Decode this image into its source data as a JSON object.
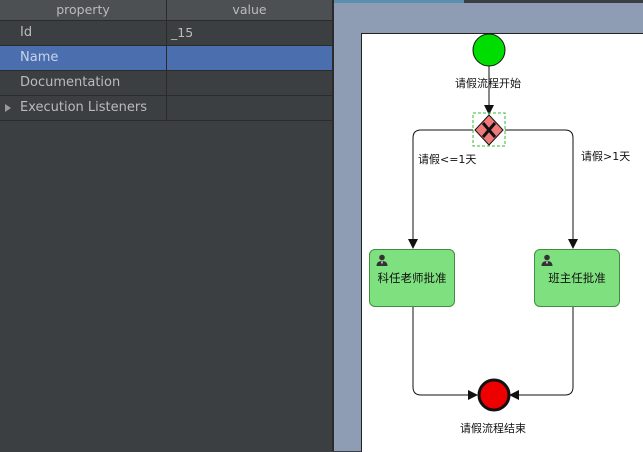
{
  "properties": {
    "header": {
      "property": "property",
      "value": "value"
    },
    "rows": [
      {
        "key": "Id",
        "value": "_15"
      },
      {
        "key": "Name",
        "value": ""
      },
      {
        "key": "Documentation",
        "value": ""
      },
      {
        "key": "Execution Listeners",
        "value": ""
      }
    ]
  },
  "diagram": {
    "start_event": {
      "label": "请假流程开始",
      "color": "#00dd00"
    },
    "gateway": {
      "color": "#f07a7a"
    },
    "flow_left": {
      "label": "请假<=1天"
    },
    "flow_right": {
      "label": "请假>1天"
    },
    "task_left": {
      "label": "科任老师批准",
      "icon": "user-icon"
    },
    "task_right": {
      "label": "班主任批准",
      "icon": "user-icon"
    },
    "end_event": {
      "label": "请假流程结束",
      "color": "#ee0000"
    }
  }
}
